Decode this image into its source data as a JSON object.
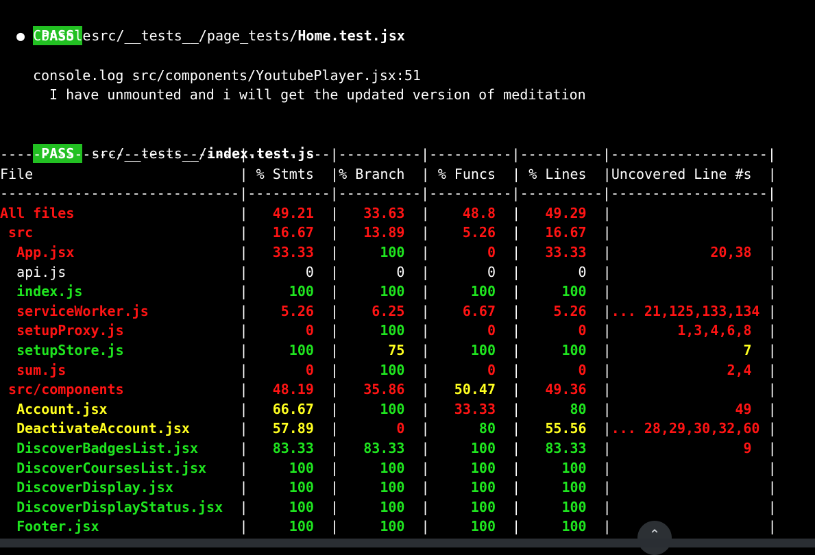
{
  "pass1": {
    "badge": "PASS",
    "path": "src/__tests__/page_tests/",
    "file": "Home.test.jsx"
  },
  "console_label": "● Console",
  "console_log": "console.log src/components/YoutubePlayer.jsx:51",
  "console_msg": "I have unmounted and i will get the updated version of meditation",
  "pass2": {
    "badge": "PASS",
    "path": "src/__tests__/",
    "file": "index.test.js"
  },
  "table": {
    "sep": "-----------------------------|----------|----------|----------|----------|-------------------|",
    "headers": [
      "File",
      "% Stmts",
      "% Branch",
      "% Funcs",
      "% Lines",
      "Uncovered Line #s"
    ],
    "rows": [
      {
        "name": "All files",
        "indent": 0,
        "color": "red",
        "vals": [
          {
            "v": "49.21",
            "c": "red"
          },
          {
            "v": "33.63",
            "c": "red"
          },
          {
            "v": "48.8",
            "c": "red"
          },
          {
            "v": "49.29",
            "c": "red"
          }
        ],
        "unc": "",
        "uc": "red"
      },
      {
        "name": "src",
        "indent": 1,
        "color": "red",
        "vals": [
          {
            "v": "16.67",
            "c": "red"
          },
          {
            "v": "13.89",
            "c": "red"
          },
          {
            "v": "5.26",
            "c": "red"
          },
          {
            "v": "16.67",
            "c": "red"
          }
        ],
        "unc": "",
        "uc": "red"
      },
      {
        "name": "App.jsx",
        "indent": 2,
        "color": "red",
        "vals": [
          {
            "v": "33.33",
            "c": "red"
          },
          {
            "v": "100",
            "c": "green"
          },
          {
            "v": "0",
            "c": "red"
          },
          {
            "v": "33.33",
            "c": "red"
          }
        ],
        "unc": "20,38",
        "uc": "red"
      },
      {
        "name": "api.js",
        "indent": 2,
        "color": "white",
        "vals": [
          {
            "v": "0",
            "c": "white"
          },
          {
            "v": "0",
            "c": "white"
          },
          {
            "v": "0",
            "c": "white"
          },
          {
            "v": "0",
            "c": "white"
          }
        ],
        "unc": "",
        "uc": "white"
      },
      {
        "name": "index.js",
        "indent": 2,
        "color": "green",
        "vals": [
          {
            "v": "100",
            "c": "green"
          },
          {
            "v": "100",
            "c": "green"
          },
          {
            "v": "100",
            "c": "green"
          },
          {
            "v": "100",
            "c": "green"
          }
        ],
        "unc": "",
        "uc": "green"
      },
      {
        "name": "serviceWorker.js",
        "indent": 2,
        "color": "red",
        "vals": [
          {
            "v": "5.26",
            "c": "red"
          },
          {
            "v": "6.25",
            "c": "red"
          },
          {
            "v": "6.67",
            "c": "red"
          },
          {
            "v": "5.26",
            "c": "red"
          }
        ],
        "unc": "... 21,125,133,134",
        "uc": "red"
      },
      {
        "name": "setupProxy.js",
        "indent": 2,
        "color": "red",
        "vals": [
          {
            "v": "0",
            "c": "red"
          },
          {
            "v": "100",
            "c": "green"
          },
          {
            "v": "0",
            "c": "red"
          },
          {
            "v": "0",
            "c": "red"
          }
        ],
        "unc": "1,3,4,6,8",
        "uc": "red"
      },
      {
        "name": "setupStore.js",
        "indent": 2,
        "color": "green",
        "vals": [
          {
            "v": "100",
            "c": "green"
          },
          {
            "v": "75",
            "c": "yellow"
          },
          {
            "v": "100",
            "c": "green"
          },
          {
            "v": "100",
            "c": "green"
          }
        ],
        "unc": "7",
        "uc": "yellow"
      },
      {
        "name": "sum.js",
        "indent": 2,
        "color": "red",
        "vals": [
          {
            "v": "0",
            "c": "red"
          },
          {
            "v": "100",
            "c": "green"
          },
          {
            "v": "0",
            "c": "red"
          },
          {
            "v": "0",
            "c": "red"
          }
        ],
        "unc": "2,4",
        "uc": "red"
      },
      {
        "name": "src/components",
        "indent": 1,
        "color": "red",
        "vals": [
          {
            "v": "48.19",
            "c": "red"
          },
          {
            "v": "35.86",
            "c": "red"
          },
          {
            "v": "50.47",
            "c": "yellow"
          },
          {
            "v": "49.36",
            "c": "red"
          }
        ],
        "unc": "",
        "uc": "red"
      },
      {
        "name": "Account.jsx",
        "indent": 2,
        "color": "yellow",
        "vals": [
          {
            "v": "66.67",
            "c": "yellow"
          },
          {
            "v": "100",
            "c": "green"
          },
          {
            "v": "33.33",
            "c": "red"
          },
          {
            "v": "80",
            "c": "green"
          }
        ],
        "unc": "49",
        "uc": "red"
      },
      {
        "name": "DeactivateAccount.jsx",
        "indent": 2,
        "color": "yellow",
        "vals": [
          {
            "v": "57.89",
            "c": "yellow"
          },
          {
            "v": "0",
            "c": "red"
          },
          {
            "v": "80",
            "c": "green"
          },
          {
            "v": "55.56",
            "c": "yellow"
          }
        ],
        "unc": "... 28,29,30,32,60",
        "uc": "red"
      },
      {
        "name": "DiscoverBadgesList.jsx",
        "indent": 2,
        "color": "green",
        "vals": [
          {
            "v": "83.33",
            "c": "green"
          },
          {
            "v": "83.33",
            "c": "green"
          },
          {
            "v": "100",
            "c": "green"
          },
          {
            "v": "83.33",
            "c": "green"
          }
        ],
        "unc": "9",
        "uc": "red"
      },
      {
        "name": "DiscoverCoursesList.jsx",
        "indent": 2,
        "color": "green",
        "vals": [
          {
            "v": "100",
            "c": "green"
          },
          {
            "v": "100",
            "c": "green"
          },
          {
            "v": "100",
            "c": "green"
          },
          {
            "v": "100",
            "c": "green"
          }
        ],
        "unc": "",
        "uc": "green"
      },
      {
        "name": "DiscoverDisplay.jsx",
        "indent": 2,
        "color": "green",
        "vals": [
          {
            "v": "100",
            "c": "green"
          },
          {
            "v": "100",
            "c": "green"
          },
          {
            "v": "100",
            "c": "green"
          },
          {
            "v": "100",
            "c": "green"
          }
        ],
        "unc": "",
        "uc": "green"
      },
      {
        "name": "DiscoverDisplayStatus.jsx",
        "indent": 2,
        "color": "green",
        "vals": [
          {
            "v": "100",
            "c": "green"
          },
          {
            "v": "100",
            "c": "green"
          },
          {
            "v": "100",
            "c": "green"
          },
          {
            "v": "100",
            "c": "green"
          }
        ],
        "unc": "",
        "uc": "green"
      },
      {
        "name": "Footer.jsx",
        "indent": 2,
        "color": "green",
        "vals": [
          {
            "v": "100",
            "c": "green"
          },
          {
            "v": "100",
            "c": "green"
          },
          {
            "v": "100",
            "c": "green"
          },
          {
            "v": "100",
            "c": "green"
          }
        ],
        "unc": "",
        "uc": "green"
      }
    ]
  },
  "scroll_icon": "chevron-up-icon"
}
